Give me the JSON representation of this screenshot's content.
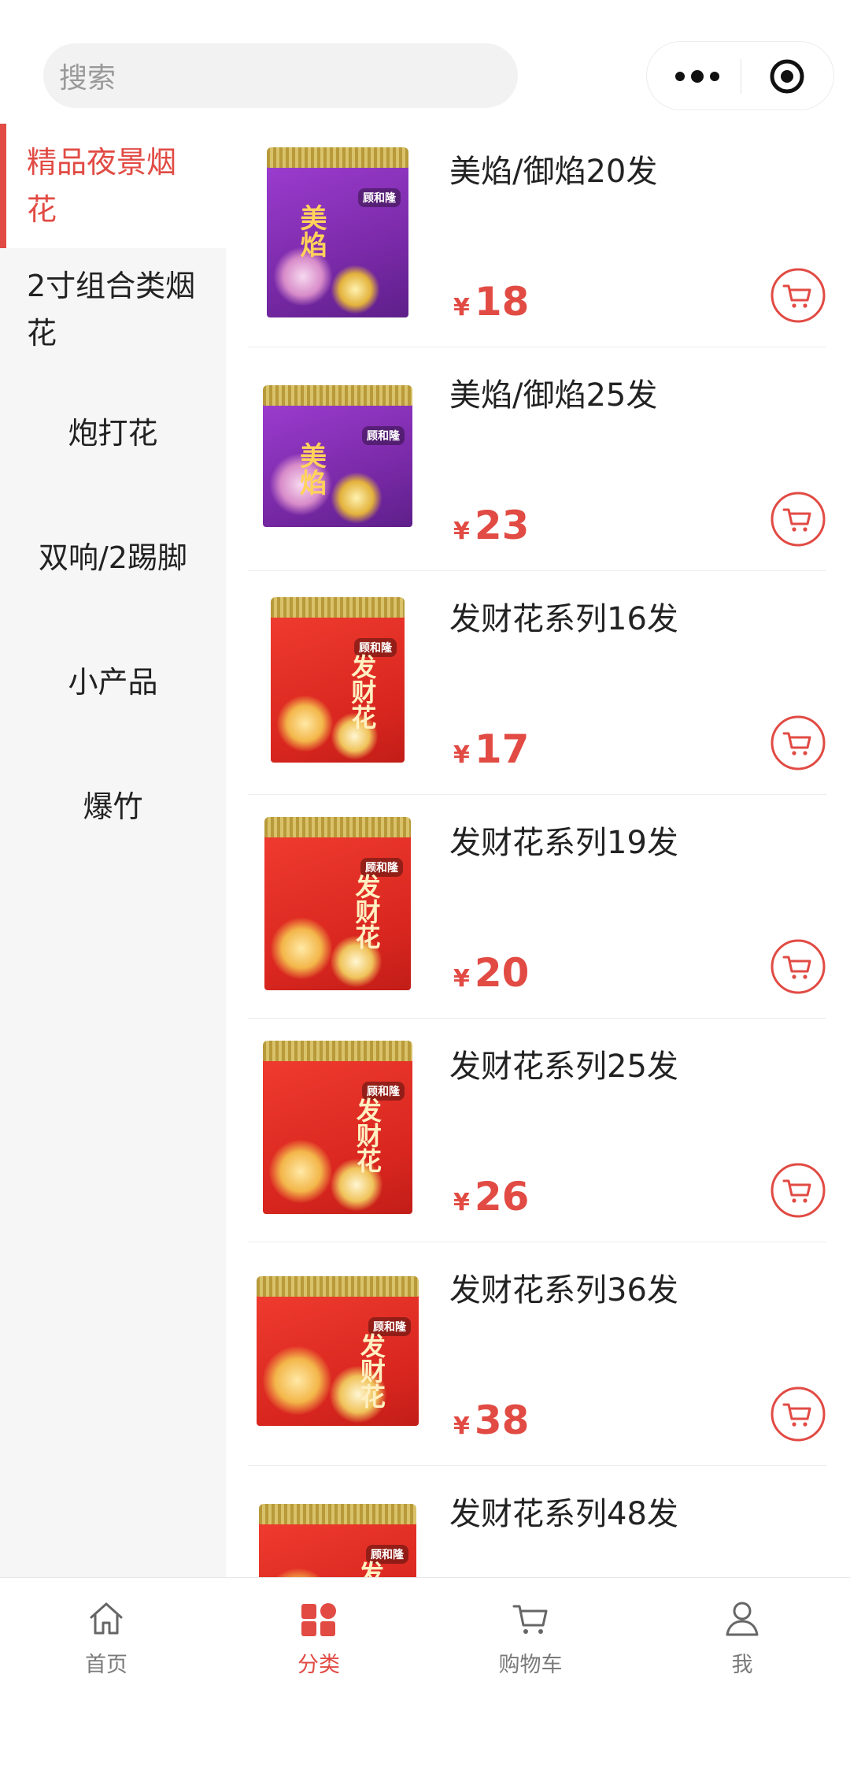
{
  "search": {
    "placeholder": "搜索"
  },
  "categories": [
    {
      "label": "精品夜景烟花"
    },
    {
      "label": "2寸组合类烟花"
    },
    {
      "label": "炮打花"
    },
    {
      "label": "双响/2踢脚"
    },
    {
      "label": "小产品"
    },
    {
      "label": "爆竹"
    }
  ],
  "products": [
    {
      "name": "美焰/御焰20发",
      "currency": "¥",
      "price": "18",
      "style": "purple"
    },
    {
      "name": "美焰/御焰25发",
      "currency": "¥",
      "price": "23",
      "style": "purple"
    },
    {
      "name": "发财花系列16发",
      "currency": "¥",
      "price": "17",
      "style": "red"
    },
    {
      "name": "发财花系列19发",
      "currency": "¥",
      "price": "20",
      "style": "red"
    },
    {
      "name": "发财花系列25发",
      "currency": "¥",
      "price": "26",
      "style": "red"
    },
    {
      "name": "发财花系列36发",
      "currency": "¥",
      "price": "38",
      "style": "red"
    },
    {
      "name": "发财花系列48发",
      "currency": "",
      "price": "",
      "style": "red"
    }
  ],
  "box_art": {
    "brand": "顾和隆",
    "purple_title": "美焰",
    "red_title": "发财花"
  },
  "tabs": [
    {
      "label": "首页",
      "icon": "home-icon"
    },
    {
      "label": "分类",
      "icon": "category-icon"
    },
    {
      "label": "购物车",
      "icon": "cart-icon"
    },
    {
      "label": "我",
      "icon": "user-icon"
    }
  ],
  "colors": {
    "accent": "#e14b44",
    "sidebar_bg": "#f6f6f6",
    "purple_box": "#8a34b8",
    "red_box": "#e2322a"
  }
}
